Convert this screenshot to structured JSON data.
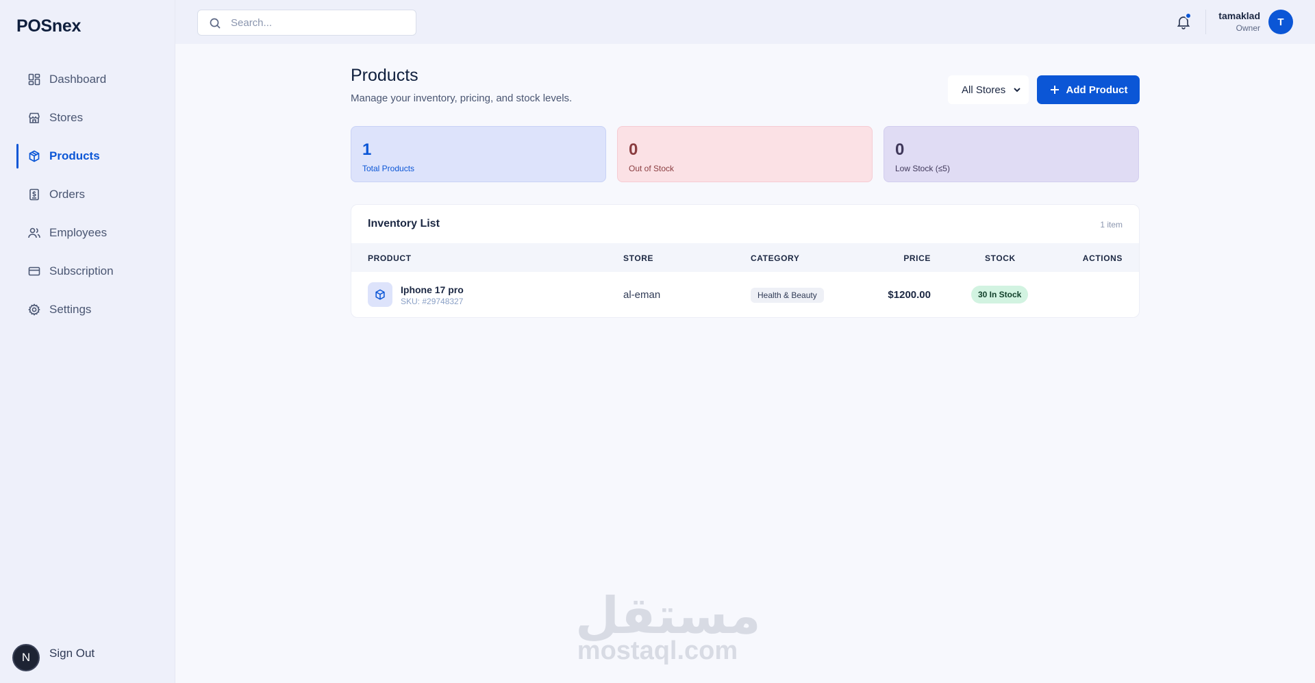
{
  "brand": "POSnex",
  "sidebar": {
    "items": [
      {
        "label": "Dashboard",
        "icon": "dashboard-icon"
      },
      {
        "label": "Stores",
        "icon": "store-icon"
      },
      {
        "label": "Products",
        "icon": "box-icon",
        "active": true
      },
      {
        "label": "Orders",
        "icon": "receipt-icon"
      },
      {
        "label": "Employees",
        "icon": "users-icon"
      },
      {
        "label": "Subscription",
        "icon": "credit-card-icon"
      },
      {
        "label": "Settings",
        "icon": "gear-icon"
      }
    ],
    "signout_label": "Sign Out",
    "badge_letter": "N"
  },
  "topbar": {
    "search_placeholder": "Search...",
    "user_name": "tamaklad",
    "user_role": "Owner",
    "avatar_letter": "T"
  },
  "page": {
    "title": "Products",
    "subtitle": "Manage your inventory, pricing, and stock levels.",
    "store_filter": "All Stores",
    "add_button": "Add Product"
  },
  "stats": [
    {
      "value": "1",
      "label": "Total Products"
    },
    {
      "value": "0",
      "label": "Out of Stock"
    },
    {
      "value": "0",
      "label": "Low Stock (≤5)"
    }
  ],
  "inventory": {
    "title": "Inventory List",
    "count": "1 item",
    "columns": [
      "PRODUCT",
      "STORE",
      "CATEGORY",
      "PRICE",
      "STOCK",
      "ACTIONS"
    ],
    "rows": [
      {
        "name": "Iphone 17 pro",
        "sku": "SKU: #29748327",
        "store": "al-eman",
        "category": "Health & Beauty",
        "price": "$1200.00",
        "stock": "30 In Stock"
      }
    ]
  },
  "watermark": {
    "arabic": "مستقل",
    "latin": "mostaql.com"
  },
  "colors": {
    "accent": "#0b56d6",
    "sidebar_bg": "#eef0fa",
    "page_bg": "#f7f8fd"
  }
}
